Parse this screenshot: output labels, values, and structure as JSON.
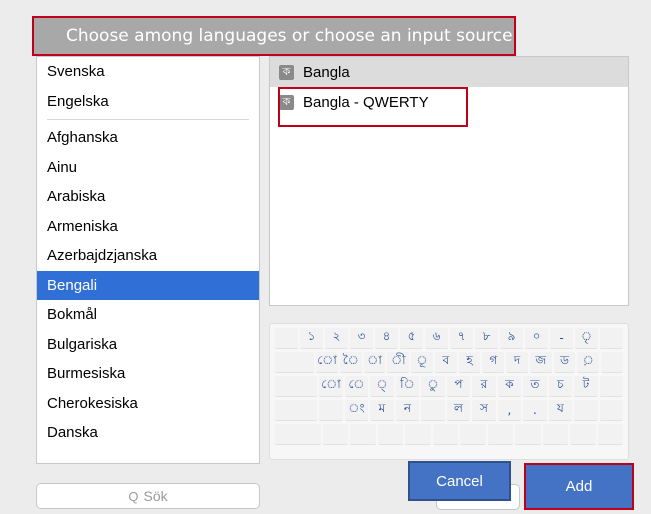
{
  "banner": {
    "text": "Choose among languages or choose an input source"
  },
  "languages": {
    "preferred": [
      "Svenska",
      "Engelska"
    ],
    "all": [
      "Afghanska",
      "Ainu",
      "Arabiska",
      "Armeniska",
      "Azerbajdzjanska",
      "Bengali",
      "Bokmål",
      "Bulgariska",
      "Burmesiska",
      "Cherokesiska",
      "Danska"
    ],
    "selected": "Bengali"
  },
  "input_sources": {
    "items": [
      {
        "icon_glyph": "ক",
        "label": "Bangla",
        "selected": true
      },
      {
        "icon_glyph": "ক",
        "label": "Bangla - QWERTY",
        "selected": false
      }
    ]
  },
  "keyboard": {
    "rows": [
      [
        "",
        "১",
        "২",
        "৩",
        "৪",
        "৫",
        "৬",
        "৭",
        "৮",
        "৯",
        "০",
        "-",
        "ৃ",
        ""
      ],
      [
        "",
        "ো",
        "ৈ",
        "া",
        "ী",
        "ূ",
        "ব",
        "হ",
        "গ",
        "দ",
        "জ",
        "ড",
        "়",
        ""
      ],
      [
        "",
        "ো",
        "ে",
        "্",
        "ি",
        "ু",
        "প",
        "র",
        "ক",
        "ত",
        "চ",
        "ট",
        ""
      ],
      [
        "",
        "",
        "ং",
        "ম",
        "ন",
        "",
        "ল",
        "স",
        ",",
        ".",
        "য",
        "",
        ""
      ],
      [
        "",
        "",
        "",
        "",
        "",
        "",
        "",
        "",
        "",
        "",
        "",
        ""
      ]
    ]
  },
  "search": {
    "icon": "magnifier-icon",
    "glyph": "Q",
    "placeholder": "Sök"
  },
  "buttons": {
    "cancel": "Cancel",
    "add": "Add"
  },
  "colors": {
    "accent": "#2f6fd6",
    "button": "#4472c4",
    "highlight_border": "#c0001a",
    "banner_bg": "#a8a8a8"
  }
}
